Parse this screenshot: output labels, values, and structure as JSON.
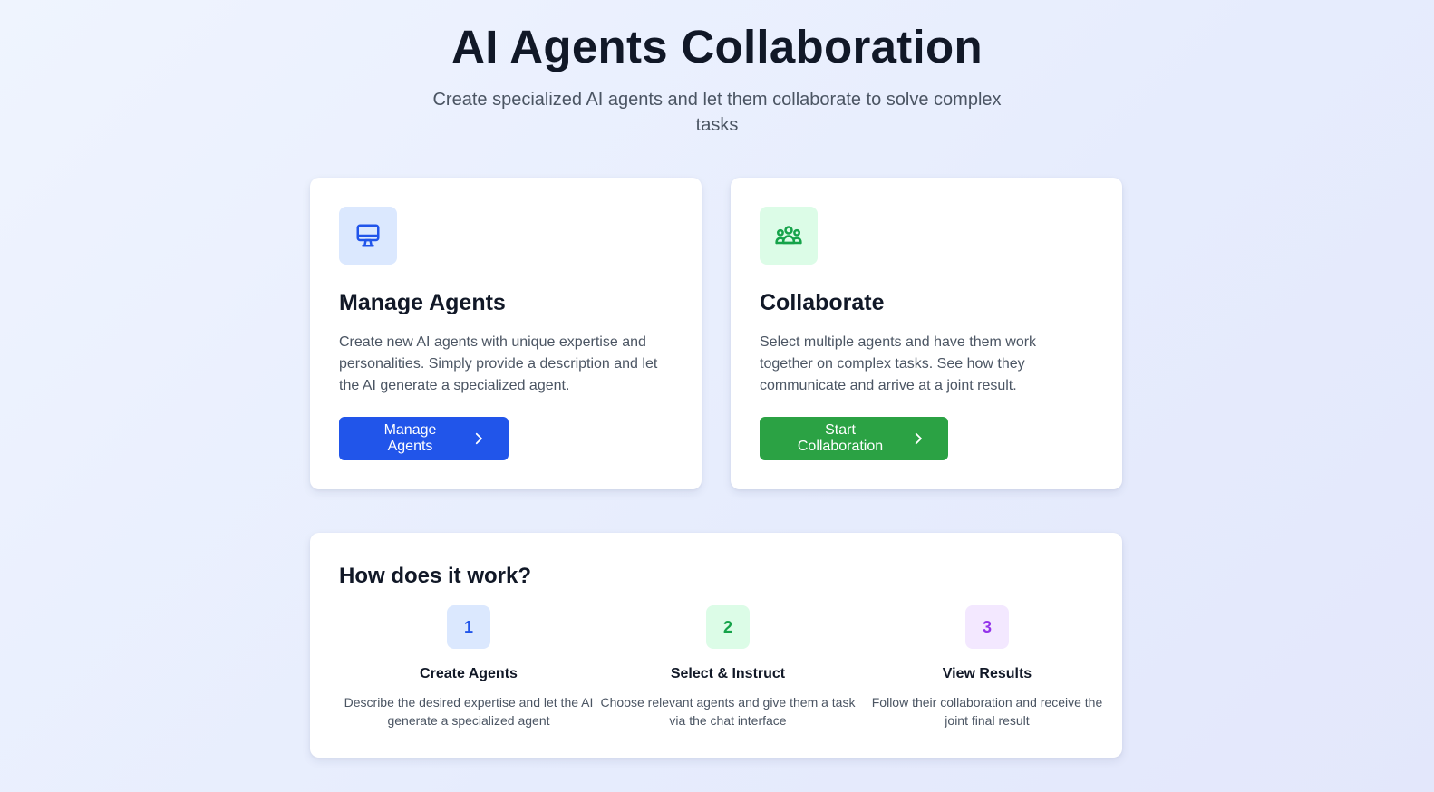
{
  "header": {
    "title": "AI Agents Collaboration",
    "subtitle": "Create specialized AI agents and let them collaborate to solve complex tasks"
  },
  "cards": {
    "manage": {
      "icon": "monitor-icon",
      "title": "Manage Agents",
      "description": "Create new AI agents with unique expertise and personalities. Simply provide a description and let the AI generate a specialized agent.",
      "button_label": "Manage Agents",
      "accent": "#2155ea",
      "icon_bg": "#dbe8fe"
    },
    "collaborate": {
      "icon": "users-group-icon",
      "title": "Collaborate",
      "description": "Select multiple agents and have them work together on complex tasks. See how they communicate and arrive at a joint result.",
      "button_label": "Start Collaboration",
      "accent": "#2ba244",
      "icon_bg": "#dcfce7"
    }
  },
  "how": {
    "title": "How does it work?",
    "steps": [
      {
        "number": "1",
        "title": "Create Agents",
        "text": "Describe the desired expertise and let the AI generate a specialized agent",
        "color": "#2155ea",
        "bg": "#dbe8fe"
      },
      {
        "number": "2",
        "title": "Select & Instruct",
        "text": "Choose relevant agents and give them a task via the chat interface",
        "color": "#16a34a",
        "bg": "#dcfce7"
      },
      {
        "number": "3",
        "title": "View Results",
        "text": "Follow their collaboration and receive the joint final result",
        "color": "#9333ea",
        "bg": "#f3e8ff"
      }
    ]
  }
}
